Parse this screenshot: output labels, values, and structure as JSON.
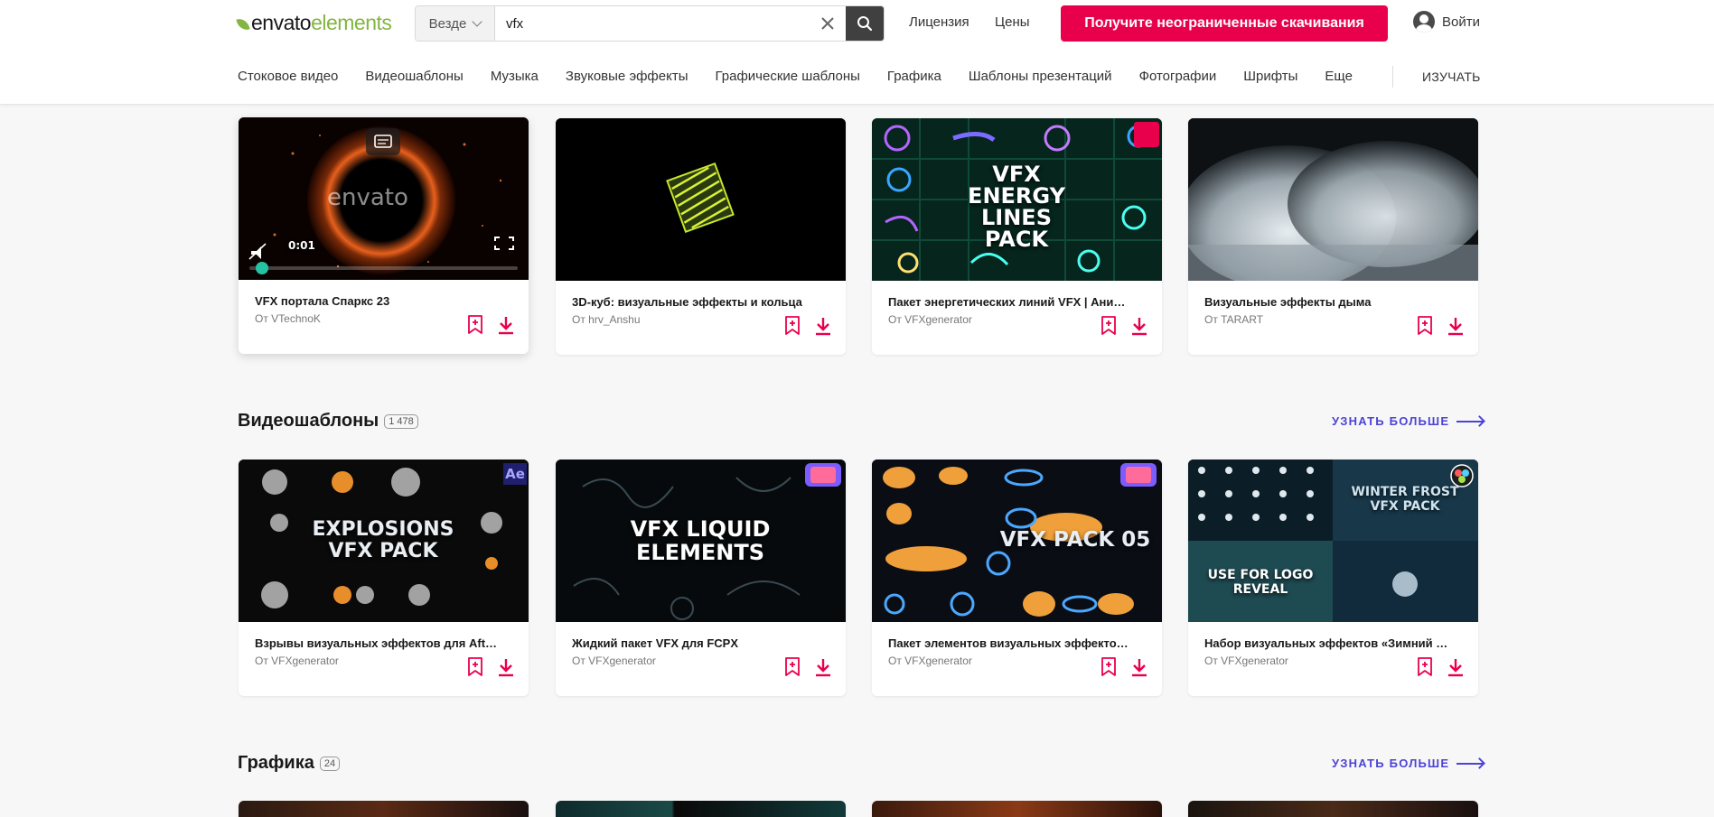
{
  "header": {
    "logo_part1": "envato",
    "logo_part2": "elements",
    "search_scope": "Везде",
    "search_value": "vfx",
    "license_link": "Лицензия",
    "prices_link": "Цены",
    "cta_label": "Получите неограниченные скачивания",
    "signin_label": "Войти"
  },
  "nav": {
    "items": [
      "Стоковое видео",
      "Видеошаблоны",
      "Музыка",
      "Звуковые эффекты",
      "Графические шаблоны",
      "Графика",
      "Шаблоны презентаций",
      "Фотографии",
      "Шрифты",
      "Еще"
    ],
    "learn": "ИЗУЧАТЬ"
  },
  "stock_video": {
    "cards": [
      {
        "title": "VFX портала Спаркс 23",
        "author": "От VTechnoK",
        "time": "0:01",
        "watermark": "envato",
        "progress": 0.02
      },
      {
        "title": "3D-куб: визуальные эффекты и кольца",
        "author": "От hrv_Anshu"
      },
      {
        "title": "Пакет энергетических линий VFX | Анимиро...",
        "author": "От VFXgenerator",
        "overlay": "VFX ENERGY LINES PACK"
      },
      {
        "title": "Визуальные эффекты дыма",
        "author": "От TARART"
      }
    ]
  },
  "video_templates": {
    "title": "Видеошаблоны",
    "count": "1 478",
    "more": "УЗНАТЬ БОЛЬШЕ",
    "cards": [
      {
        "title": "Взрывы визуальных эффектов для After Eff...",
        "author": "От VFXgenerator",
        "overlay": "EXPLOSIONS VFX PACK",
        "badge": "Ae"
      },
      {
        "title": "Жидкий пакет VFX для FCPX",
        "author": "От VFXgenerator",
        "overlay": "VFX LIQUID ELEMENTS"
      },
      {
        "title": "Пакет элементов визуальных эффектов для...",
        "author": "От VFXgenerator",
        "overlay": "VFX PACK 05"
      },
      {
        "title": "Набор визуальных эффектов «Зимний мор...",
        "author": "От VFXgenerator",
        "overlay": "WINTER FROST VFX PACK",
        "overlay2": "USE FOR LOGO REVEAL"
      }
    ]
  },
  "graphics": {
    "title": "Графика",
    "count": "24",
    "more": "УЗНАТЬ БОЛЬШЕ"
  },
  "colors": {
    "accent": "#e9004c",
    "link": "#4c43d6",
    "brand": "#82b541"
  }
}
